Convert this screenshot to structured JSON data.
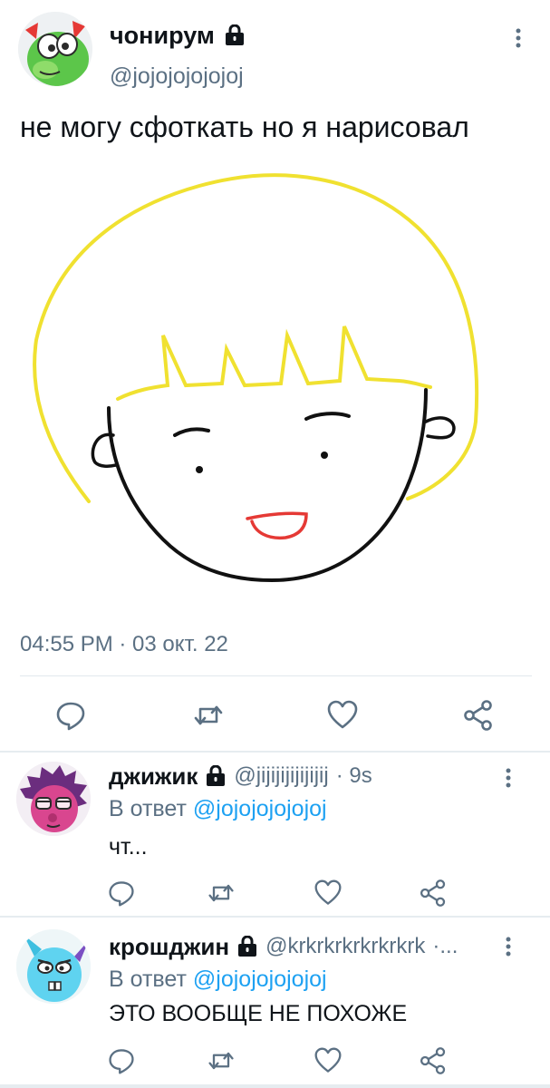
{
  "tweet": {
    "author_name": "чонирум",
    "author_handle": "@jojojojojojoj",
    "text": "не могу сфоткать но я нарисовал",
    "timestamp": "04:55 PM · 03 окт. 22"
  },
  "replies": [
    {
      "name": "джижик",
      "handle": "@jijijijijijijij",
      "time": "· 9s",
      "reply_prefix": "В ответ",
      "reply_to": "@jojojojojojoj",
      "text": "чт..."
    },
    {
      "name": "крошджин",
      "handle": "@krkrkrkrkrkrkrk",
      "time": "·...",
      "reply_prefix": "В ответ",
      "reply_to": "@jojojojojojoj",
      "text": "ЭТО ВООБЩЕ НЕ ПОХОЖЕ"
    }
  ],
  "icons": {
    "lock": "lock-icon",
    "more": "more-vertical-icon",
    "reply": "reply-icon",
    "retweet": "retweet-icon",
    "like": "heart-icon",
    "share": "share-icon"
  },
  "colors": {
    "accent": "#1da1f2",
    "secondary_text": "#5b7083",
    "icon": "#5b7083",
    "hair": "#f0e130",
    "mouth": "#e53935"
  }
}
